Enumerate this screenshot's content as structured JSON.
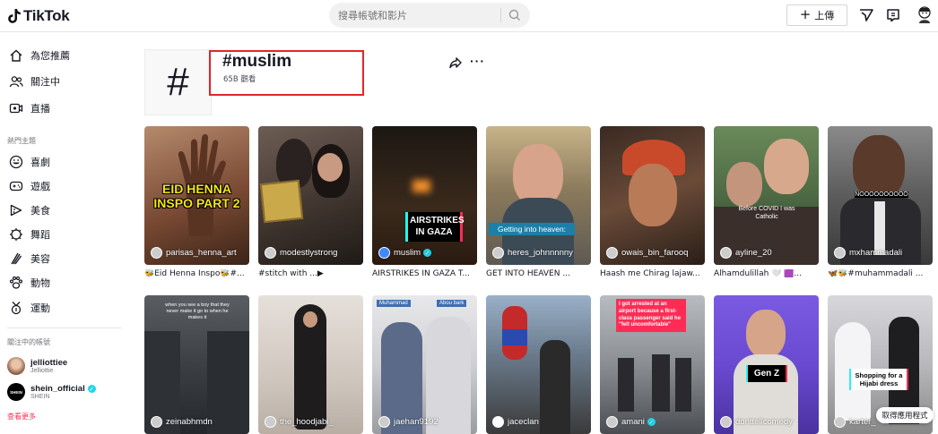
{
  "header": {
    "logo_text": "TikTok",
    "search_placeholder": "搜尋帳號和影片",
    "upload_label": "上傳"
  },
  "sidebar": {
    "nav": [
      {
        "label": "為您推薦",
        "icon": "home-icon"
      },
      {
        "label": "關注中",
        "icon": "following-icon"
      },
      {
        "label": "直播",
        "icon": "live-icon"
      }
    ],
    "topics_title": "熱門主題",
    "topics": [
      {
        "label": "喜劇",
        "icon": "comedy-icon"
      },
      {
        "label": "遊戲",
        "icon": "gaming-icon"
      },
      {
        "label": "美食",
        "icon": "food-icon"
      },
      {
        "label": "舞蹈",
        "icon": "dance-icon"
      },
      {
        "label": "美容",
        "icon": "beauty-icon"
      },
      {
        "label": "動物",
        "icon": "animals-icon"
      },
      {
        "label": "運動",
        "icon": "sports-icon"
      }
    ],
    "following_title": "關注中的帳號",
    "accounts": [
      {
        "username": "jelliottiee",
        "display": "Jelliottie",
        "verified": false
      },
      {
        "username": "shein_official",
        "display": "SHEIN",
        "verified": true
      }
    ],
    "see_more": "查看更多"
  },
  "tag": {
    "title": "#muslim",
    "views": "65B 觀看"
  },
  "videos_row1": [
    {
      "creator": "parisas_henna_art",
      "caption": "🐝Eid Henna Inspo🐝#...",
      "overlay": "EID HENNA INSPO PART 2"
    },
    {
      "creator": "modestlystrong",
      "caption": "#stitch with ...▶",
      "overlay": ""
    },
    {
      "creator": "muslim",
      "caption": "AIRSTRIKES IN GAZA T...",
      "overlay": "AIRSTRIKES IN GAZA",
      "verified": true
    },
    {
      "creator": "heres_johnnnnny",
      "caption": "GET INTO HEAVEN ...",
      "overlay": "Getting into heaven:"
    },
    {
      "creator": "owais_bin_farooq",
      "caption": "Haash me Chirag lajaw...",
      "overlay": ""
    },
    {
      "creator": "ayline_20",
      "caption": "Alhamdulillah 🤍 🟪...",
      "overlay": "Before COVID I was Catholic"
    },
    {
      "creator": "mxhammadali",
      "caption": "🦋🐝#muhammadali ...",
      "overlay": "NOOOOOOOOOO"
    }
  ],
  "videos_row2": [
    {
      "creator": "zeinabhmdn",
      "overlay": "when you see a boy that they never make it go to when he makes it"
    },
    {
      "creator": "the_hoodjabi_",
      "overlay": ""
    },
    {
      "creator": "jaehan9192",
      "overlay_left": "Muhammad",
      "overlay_right": "Abou bark"
    },
    {
      "creator": "jaceclan",
      "overlay": ""
    },
    {
      "creator": "amani",
      "overlay": "I got arrested at an airport because a first-class passenger said he \"felt uncomfortable\"",
      "verified": true
    },
    {
      "creator": "donttellcomedy",
      "overlay": "Gen Z"
    },
    {
      "creator": "karter_",
      "overlay": "Shopping for a Hijabi dress"
    }
  ],
  "get_app": "取得應用程式"
}
